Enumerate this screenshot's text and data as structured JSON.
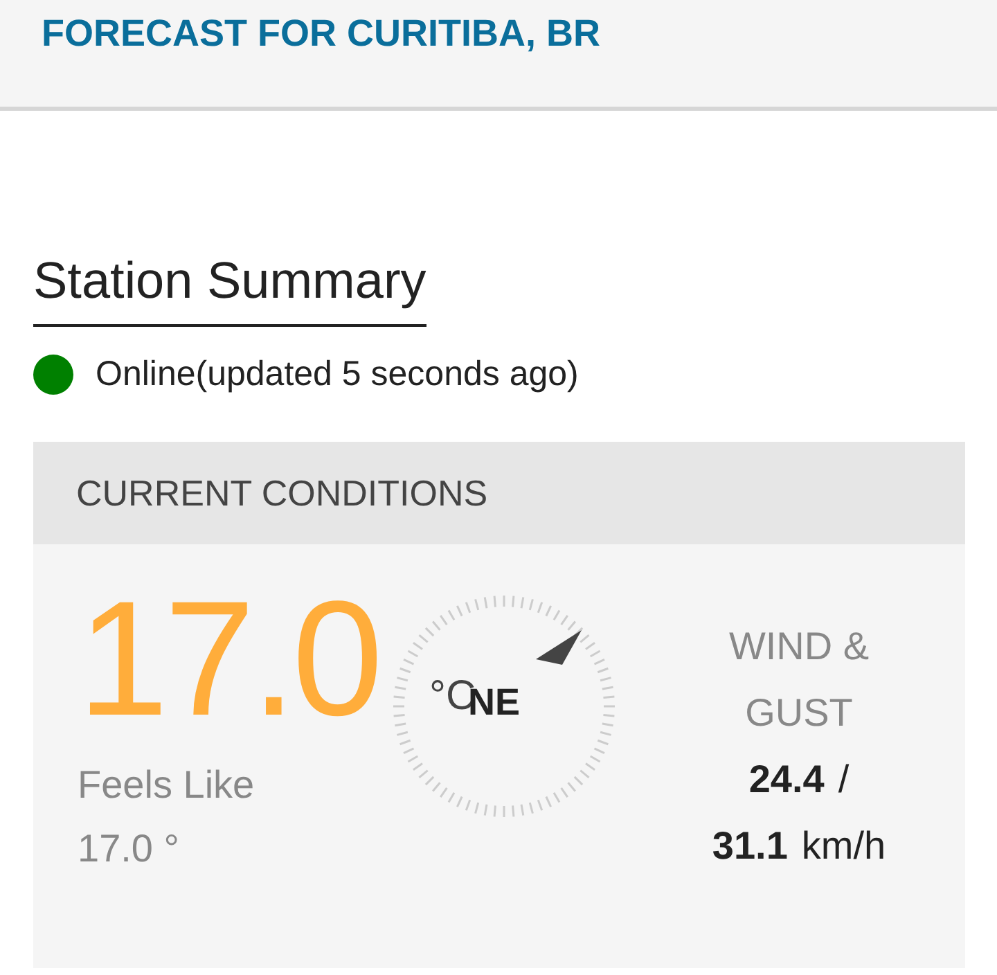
{
  "header": {
    "title": "FORECAST FOR CURITIBA, BR"
  },
  "station_summary": {
    "heading": "Station Summary",
    "online": true,
    "status": "Online(updated 5 seconds ago)"
  },
  "current_conditions": {
    "heading": "CURRENT CONDITIONS",
    "temperature": "17.0",
    "feels_like_label": "Feels Like",
    "feels_like_value": "17.0 °",
    "compass_unit": "°C",
    "wind_direction": "NE",
    "wind_label_lines": [
      "WIND &",
      "GUST"
    ],
    "wind_speed": "24.4",
    "wind_separator": "/",
    "gust_speed": "31.1",
    "wind_unit": "km/h"
  }
}
